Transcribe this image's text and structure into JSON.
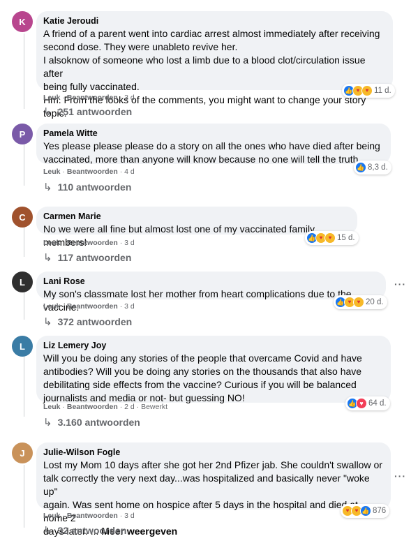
{
  "actions": {
    "like_label": "Leuk",
    "reply_label": "Beantwoorden",
    "edited_label": "Bewerkt",
    "sep": "·",
    "more_icon": "···"
  },
  "comments": [
    {
      "author": "Katie Jeroudi",
      "avatar_color": "#b8468e",
      "initial": "K",
      "text_lines": [
        "A friend of a parent went into cardiac arrest almost immediately after receiving",
        "second dose. They were unableto revive her.",
        "I alsoknow of someone who lost a limb due to a blood clot/circulation issue after",
        "being fully vaccinated.",
        "Hm. From the looks of the comments, you might want to change your story topic."
      ],
      "time": "3 d",
      "reaction_icons": [
        "like-icon",
        "care-icon",
        "care-icon"
      ],
      "reaction_count": "11 d.",
      "replies": "251 antwoorden"
    },
    {
      "author": "Pamela Witte",
      "avatar_color": "#7a5aa8",
      "initial": "P",
      "text_lines": [
        "Yes please please please do a story on all the ones who have died after being",
        "vaccinated, more than anyone will know because no one will tell the truth"
      ],
      "time": "4 d",
      "reaction_icons": [
        "like-icon"
      ],
      "reaction_count": "8,3 d.",
      "replies": "110 antwoorden"
    },
    {
      "author": "Carmen Marie",
      "avatar_color": "#a0522d",
      "initial": "C",
      "text_lines": [
        "No we were all fine but almost lost one of my vaccinated family members!"
      ],
      "time": "3 d",
      "reaction_icons": [
        "like-icon",
        "care-icon",
        "care-icon"
      ],
      "reaction_count": "15 d.",
      "replies": "117 antwoorden"
    },
    {
      "author": "Lani Rose",
      "avatar_color": "#2f2f2f",
      "initial": "L",
      "text_lines": [
        "My son's classmate lost her mother from heart complications due to the vaccine."
      ],
      "time": "3 d",
      "reaction_icons": [
        "like-icon",
        "care-icon",
        "care-icon"
      ],
      "reaction_count": "20 d.",
      "replies": "372 antwoorden"
    },
    {
      "author": "Liz Lemery Joy",
      "avatar_color": "#3a7ca5",
      "initial": "L",
      "text_lines": [
        "Will you be doing any stories of the people that overcame Covid and have",
        "antibodies? Will you be doing any stories on the thousands that also have",
        "debilitating side effects from the vaccine? Curious if you will be balanced",
        "journalists and media or not- but guessing NO!"
      ],
      "time": "2 d",
      "edited": true,
      "reaction_icons": [
        "like-icon",
        "love-icon"
      ],
      "reaction_count": "64 d.",
      "replies": "3.160 antwoorden"
    },
    {
      "author": "Julie-Wilson Fogle",
      "avatar_color": "#c9925a",
      "initial": "J",
      "text_lines": [
        "Lost my Mom 10 days after she got her 2nd Pfizer jab. She couldn't swallow or",
        "talk correctly the very next day...was hospitalized and basically never \"woke up\"",
        "again. Was sent home on hospice after 5 days in the hospital and died at home 2",
        "days later. ..."
      ],
      "more_label": "Meer weergeven",
      "time": "3 d",
      "reaction_icons": [
        "care-icon",
        "care-icon",
        "like-icon"
      ],
      "reaction_count": "876",
      "replies": "32 antwoorden"
    }
  ]
}
